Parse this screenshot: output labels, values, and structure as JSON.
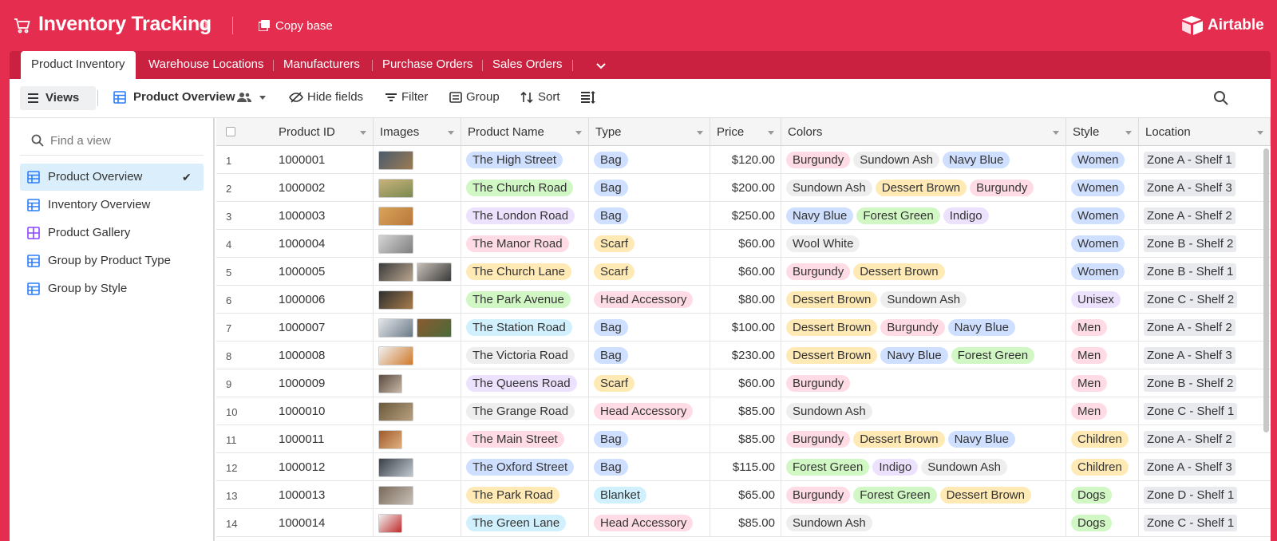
{
  "app": {
    "title": "Inventory Tracking",
    "copy_base": "Copy base",
    "logo_text": "Airtable"
  },
  "tabs": {
    "active": "Product Inventory",
    "others": [
      "Warehouse Locations",
      "Manufacturers",
      "Purchase Orders",
      "Sales Orders"
    ]
  },
  "toolbar": {
    "views": "Views",
    "current_view": "Product Overview",
    "hide_fields": "Hide fields",
    "filter": "Filter",
    "group": "Group",
    "sort": "Sort"
  },
  "sidebar": {
    "search_placeholder": "Find a view",
    "views": [
      {
        "label": "Product Overview",
        "type": "grid",
        "active": true
      },
      {
        "label": "Inventory Overview",
        "type": "grid",
        "active": false
      },
      {
        "label": "Product Gallery",
        "type": "gallery",
        "active": false
      },
      {
        "label": "Group by Product Type",
        "type": "grid",
        "active": false
      },
      {
        "label": "Group by Style",
        "type": "grid",
        "active": false
      }
    ]
  },
  "columns": [
    "Product ID",
    "Images",
    "Product Name",
    "Type",
    "Price",
    "Colors",
    "Style",
    "Location"
  ],
  "colors": {
    "brand": "#e42d4f",
    "tab_strip": "#c9213f",
    "pill": {
      "red": "#ffdce5",
      "green": "#d1f7c4",
      "purple": "#ede2fe",
      "blue": "#cfdfff",
      "yellow": "#ffeab6",
      "gray": "#eeeeee",
      "pink": "#ffdaf6",
      "teal": "#d0f0fd",
      "orange": "#fee2d5"
    }
  },
  "rows": [
    {
      "num": "1",
      "id": "1000001",
      "images": 1,
      "name": "The High Street",
      "name_color": "blue",
      "type": "Bag",
      "type_color": "blue",
      "price": "$120.00",
      "colors": [
        "Burgundy",
        "Sundown Ash",
        "Navy Blue"
      ],
      "style": "Women",
      "location": "Zone A - Shelf 1"
    },
    {
      "num": "2",
      "id": "1000002",
      "images": 1,
      "name": "The Church Road",
      "name_color": "green",
      "type": "Bag",
      "type_color": "blue",
      "price": "$200.00",
      "colors": [
        "Sundown Ash",
        "Dessert Brown",
        "Burgundy"
      ],
      "style": "Women",
      "location": "Zone A - Shelf 3"
    },
    {
      "num": "3",
      "id": "1000003",
      "images": 1,
      "name": "The London Road",
      "name_color": "purple",
      "type": "Bag",
      "type_color": "blue",
      "price": "$250.00",
      "colors": [
        "Navy Blue",
        "Forest Green",
        "Indigo"
      ],
      "style": "Women",
      "location": "Zone A - Shelf 2"
    },
    {
      "num": "4",
      "id": "1000004",
      "images": 1,
      "name": "The Manor Road",
      "name_color": "red",
      "type": "Scarf",
      "type_color": "yellow",
      "price": "$60.00",
      "colors": [
        "Wool White"
      ],
      "style": "Women",
      "location": "Zone B - Shelf 2"
    },
    {
      "num": "5",
      "id": "1000005",
      "images": 2,
      "name": "The Church Lane",
      "name_color": "yellow",
      "type": "Scarf",
      "type_color": "yellow",
      "price": "$60.00",
      "colors": [
        "Burgundy",
        "Dessert Brown"
      ],
      "style": "Women",
      "location": "Zone B - Shelf 1"
    },
    {
      "num": "6",
      "id": "1000006",
      "images": 1,
      "name": "The Park Avenue",
      "name_color": "green",
      "type": "Head Accessory",
      "type_color": "red",
      "price": "$80.00",
      "colors": [
        "Dessert Brown",
        "Sundown Ash"
      ],
      "style": "Unisex",
      "location": "Zone C - Shelf 2"
    },
    {
      "num": "7",
      "id": "1000007",
      "images": 2,
      "name": "The Station Road",
      "name_color": "teal",
      "type": "Bag",
      "type_color": "blue",
      "price": "$100.00",
      "colors": [
        "Dessert Brown",
        "Burgundy",
        "Navy Blue"
      ],
      "style": "Men",
      "location": "Zone A - Shelf 2"
    },
    {
      "num": "8",
      "id": "1000008",
      "images": 1,
      "name": "The Victoria Road",
      "name_color": "gray",
      "type": "Bag",
      "type_color": "blue",
      "price": "$230.00",
      "colors": [
        "Dessert Brown",
        "Navy Blue",
        "Forest Green"
      ],
      "style": "Men",
      "location": "Zone A - Shelf 3"
    },
    {
      "num": "9",
      "id": "1000009",
      "images": 1,
      "name": "The Queens Road",
      "name_color": "purple",
      "type": "Scarf",
      "type_color": "yellow",
      "price": "$60.00",
      "colors": [
        "Burgundy"
      ],
      "style": "Men",
      "location": "Zone B - Shelf 2"
    },
    {
      "num": "10",
      "id": "1000010",
      "images": 1,
      "name": "The Grange Road",
      "name_color": "gray",
      "type": "Head Accessory",
      "type_color": "red",
      "price": "$85.00",
      "colors": [
        "Sundown Ash"
      ],
      "style": "Men",
      "location": "Zone C - Shelf 1"
    },
    {
      "num": "11",
      "id": "1000011",
      "images": 1,
      "name": "The Main Street",
      "name_color": "red",
      "type": "Bag",
      "type_color": "blue",
      "price": "$85.00",
      "colors": [
        "Burgundy",
        "Dessert Brown",
        "Navy Blue"
      ],
      "style": "Children",
      "location": "Zone A - Shelf 2"
    },
    {
      "num": "12",
      "id": "1000012",
      "images": 1,
      "name": "The Oxford Street",
      "name_color": "blue",
      "type": "Bag",
      "type_color": "blue",
      "price": "$115.00",
      "colors": [
        "Forest Green",
        "Indigo",
        "Sundown Ash"
      ],
      "style": "Children",
      "location": "Zone A - Shelf 3"
    },
    {
      "num": "13",
      "id": "1000013",
      "images": 1,
      "name": "The Park Road",
      "name_color": "yellow",
      "type": "Blanket",
      "type_color": "teal",
      "price": "$65.00",
      "colors": [
        "Burgundy",
        "Forest Green",
        "Dessert Brown"
      ],
      "style": "Dogs",
      "location": "Zone D - Shelf 1"
    },
    {
      "num": "14",
      "id": "1000014",
      "images": 1,
      "name": "The Green Lane",
      "name_color": "teal",
      "type": "Head Accessory",
      "type_color": "red",
      "price": "$85.00",
      "colors": [
        "Sundown Ash"
      ],
      "style": "Dogs",
      "location": "Zone C - Shelf 1"
    }
  ],
  "color_map": {
    "Burgundy": "red",
    "Sundown Ash": "gray",
    "Navy Blue": "blue",
    "Dessert Brown": "yellow",
    "Forest Green": "green",
    "Indigo": "purple",
    "Wool White": "gray"
  },
  "style_map": {
    "Women": "blue",
    "Unisex": "purple",
    "Men": "red",
    "Children": "yellow",
    "Dogs": "green"
  }
}
